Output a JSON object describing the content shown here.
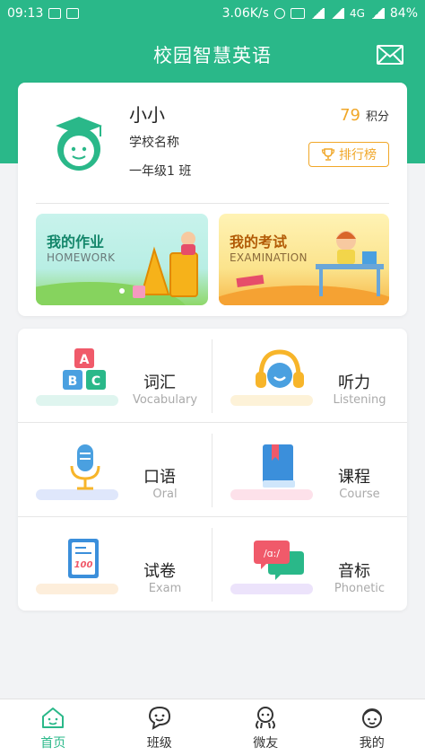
{
  "status_bar": {
    "time": "09:13",
    "speed": "3.06K/s",
    "network": "4G",
    "battery": "84%"
  },
  "header": {
    "title": "校园智慧英语"
  },
  "profile": {
    "name": "小小",
    "school": "学校名称",
    "grade": "一年级1 班",
    "points_value": "79",
    "points_unit": "积分",
    "rank_label": "排行榜"
  },
  "banners": {
    "homework": {
      "title": "我的作业",
      "subtitle": "HOMEWORK"
    },
    "exam": {
      "title": "我的考试",
      "subtitle": "EXAMINATION"
    }
  },
  "modules": [
    {
      "title": "词汇",
      "subtitle": "Vocabulary"
    },
    {
      "title": "听力",
      "subtitle": "Listening"
    },
    {
      "title": "口语",
      "subtitle": "Oral"
    },
    {
      "title": "课程",
      "subtitle": "Course"
    },
    {
      "title": "试卷",
      "subtitle": "Exam"
    },
    {
      "title": "音标",
      "subtitle": "Phonetic"
    }
  ],
  "icons": {
    "vocab_letters": [
      "A",
      "B",
      "C"
    ],
    "exam_score": "100",
    "phonetic_symbol": "/ɑ:/"
  },
  "tabs": [
    {
      "label": "首页",
      "icon": "home-icon",
      "active": true
    },
    {
      "label": "班级",
      "icon": "chat-icon",
      "active": false
    },
    {
      "label": "微友",
      "icon": "friends-icon",
      "active": false
    },
    {
      "label": "我的",
      "icon": "profile-icon",
      "active": false
    }
  ],
  "colors": {
    "brand": "#2ab889",
    "accent": "#f0a728"
  }
}
